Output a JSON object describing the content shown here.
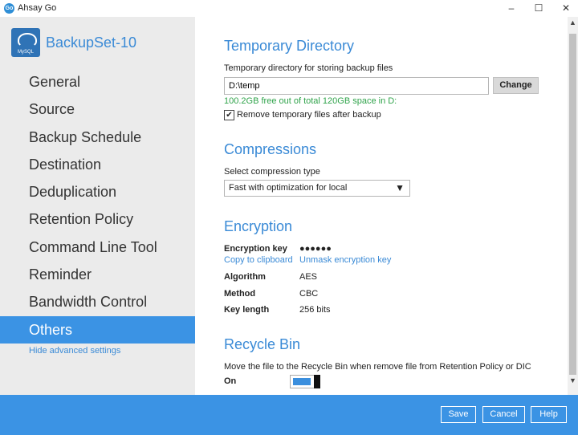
{
  "window": {
    "app_icon_text": "Go",
    "title": "Ahsay Go",
    "minimize": "–",
    "maximize": "☐",
    "close": "✕"
  },
  "sidebar": {
    "backup_set_name": "BackupSet-10",
    "db_icon_label": "MySQL",
    "items": [
      {
        "label": "General"
      },
      {
        "label": "Source"
      },
      {
        "label": "Backup Schedule"
      },
      {
        "label": "Destination"
      },
      {
        "label": "Deduplication"
      },
      {
        "label": "Retention Policy"
      },
      {
        "label": "Command Line Tool"
      },
      {
        "label": "Reminder"
      },
      {
        "label": "Bandwidth Control"
      },
      {
        "label": "Others"
      }
    ],
    "active_item": "Others",
    "hide_advanced": "Hide advanced settings"
  },
  "temp_dir": {
    "title": "Temporary Directory",
    "label": "Temporary directory for storing backup files",
    "value": "D:\\temp",
    "change_button": "Change",
    "free_space": "100.2GB free out of total 120GB space in D:",
    "remove_checkbox_checked": true,
    "remove_checkbox_label": "Remove temporary files after backup"
  },
  "compressions": {
    "title": "Compressions",
    "label": "Select compression type",
    "selected": "Fast with optimization for local"
  },
  "encryption": {
    "title": "Encryption",
    "key_label": "Encryption key",
    "key_value": "●●●●●●",
    "copy_link": "Copy to clipboard",
    "unmask_link": "Unmask encryption key",
    "algorithm_label": "Algorithm",
    "algorithm_value": "AES",
    "method_label": "Method",
    "method_value": "CBC",
    "key_length_label": "Key length",
    "key_length_value": "256 bits"
  },
  "recycle_bin": {
    "title": "Recycle Bin",
    "description": "Move the file to the Recycle Bin when remove file from Retention Policy or DIC",
    "state_label": "On",
    "enabled": true
  },
  "footer": {
    "save": "Save",
    "cancel": "Cancel",
    "help": "Help"
  },
  "colors": {
    "accent": "#3b93e4",
    "link": "#3a8ad6",
    "free_space_green": "#2fa34a",
    "sidebar_bg": "#ebebeb"
  }
}
